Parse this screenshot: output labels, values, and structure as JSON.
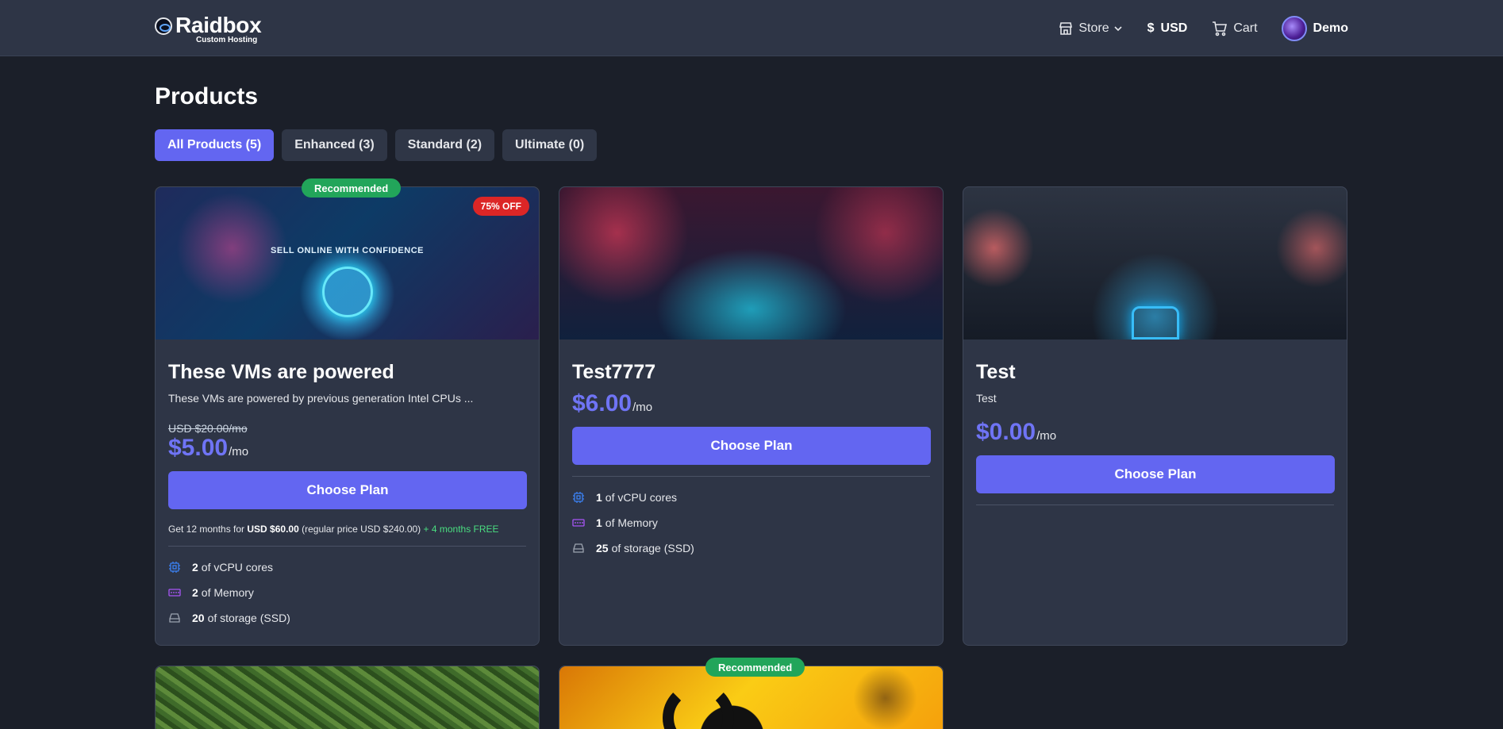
{
  "header": {
    "brand": "Raidbox",
    "tagline": "Custom Hosting",
    "nav": {
      "store": "Store",
      "currency_symbol": "$",
      "currency": "USD",
      "cart": "Cart",
      "user": "Demo"
    }
  },
  "page": {
    "title": "Products",
    "filters": [
      {
        "label": "All Products (5)",
        "active": true
      },
      {
        "label": "Enhanced (3)",
        "active": false
      },
      {
        "label": "Standard (2)",
        "active": false
      },
      {
        "label": "Ultimate (0)",
        "active": false
      }
    ]
  },
  "products": [
    {
      "badge": "Recommended",
      "discount": "75% OFF",
      "art_caption": "SELL ONLINE WITH CONFIDENCE",
      "name": "These VMs are powered",
      "description": "These VMs are powered by previous generation Intel CPUs ...",
      "old_price": "USD $20.00/mo",
      "price": "$5.00",
      "unit": "/mo",
      "cta": "Choose Plan",
      "promo_prefix": "Get 12 months for ",
      "promo_price": "USD $60.00",
      "promo_regular": " (regular price USD $240.00) ",
      "promo_free": "+ 4 months FREE",
      "specs": [
        {
          "icon": "cpu-icon",
          "value": "2",
          "label": "of vCPU cores"
        },
        {
          "icon": "memory-icon",
          "value": "2",
          "label": "of Memory"
        },
        {
          "icon": "storage-icon",
          "value": "20",
          "label": "of storage (SSD)"
        }
      ]
    },
    {
      "name": "Test7777",
      "price": "$6.00",
      "unit": "/mo",
      "cta": "Choose Plan",
      "specs": [
        {
          "icon": "cpu-icon",
          "value": "1",
          "label": "of vCPU cores"
        },
        {
          "icon": "memory-icon",
          "value": "1",
          "label": "of Memory"
        },
        {
          "icon": "storage-icon",
          "value": "25",
          "label": "of storage (SSD)"
        }
      ]
    },
    {
      "name": "Test",
      "description": "Test",
      "price": "$0.00",
      "unit": "/mo",
      "cta": "Choose Plan"
    },
    {},
    {
      "badge": "Recommended"
    }
  ],
  "colors": {
    "accent": "#6366f1",
    "recommended": "#22a55a",
    "discount": "#dc2626",
    "free": "#4ade80",
    "background": "#1b1f29",
    "card": "#2e3546"
  }
}
